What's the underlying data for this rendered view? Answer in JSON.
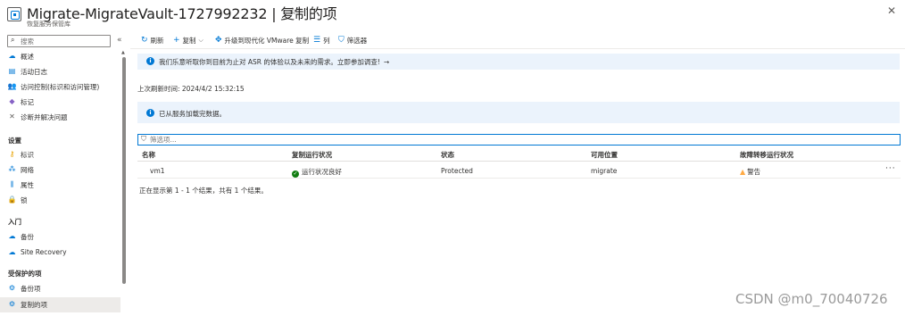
{
  "header": {
    "title": "Migrate-MigrateVault-1727992232 | 复制的项",
    "subtitle": "恢复服务保管库"
  },
  "sidebar": {
    "search_placeholder": "搜索",
    "items_top": [
      {
        "label": "概述",
        "icon": "overview-icon"
      },
      {
        "label": "活动日志",
        "icon": "activity-log-icon"
      },
      {
        "label": "访问控制(标识和访问管理)",
        "icon": "iam-icon"
      },
      {
        "label": "标记",
        "icon": "tag-icon"
      },
      {
        "label": "诊断并解决问题",
        "icon": "diagnose-icon"
      }
    ],
    "section_settings": "设置",
    "items_settings": [
      {
        "label": "标识",
        "icon": "identity-icon"
      },
      {
        "label": "网络",
        "icon": "network-icon"
      },
      {
        "label": "属性",
        "icon": "properties-icon"
      },
      {
        "label": "锁",
        "icon": "lock-icon"
      }
    ],
    "section_getstarted": "入门",
    "items_getstarted": [
      {
        "label": "备份",
        "icon": "backup-icon"
      },
      {
        "label": "Site Recovery",
        "icon": "site-recovery-icon"
      }
    ],
    "section_protected": "受保护的项",
    "items_protected": [
      {
        "label": "备份项",
        "icon": "backup-items-icon"
      },
      {
        "label": "复制的项",
        "icon": "replicated-items-icon",
        "active": true
      }
    ]
  },
  "toolbar": {
    "refresh": "刷新",
    "replicate": "复制",
    "upgrade": "升级到现代化 VMware 复制",
    "columns": "列",
    "filter": "筛选器"
  },
  "banner_survey": {
    "text": "我们乐意听取你到目前为止对 ASR 的体验以及未来的需求。立即参加调查!",
    "arrow": "→"
  },
  "last_refresh": "上次刷新时间: 2024/4/2 15:32:15",
  "banner_loaded": {
    "text": "已从服务加载完数据。"
  },
  "filter": {
    "placeholder": "筛选项..."
  },
  "table": {
    "columns": [
      "名称",
      "复制运行状况",
      "状态",
      "可用位置",
      "故障转移运行状况"
    ],
    "rows": [
      {
        "name": "vm1",
        "replication_health": "运行状况良好",
        "status": "Protected",
        "location": "migrate",
        "failover_health": "警告"
      }
    ]
  },
  "result_summary": "正在显示第 1 - 1 个结果，共有 1 个结果。",
  "watermark": "CSDN @m0_70040726",
  "colors": {
    "accent": "#0078d4",
    "banner_bg": "#ebf3fc",
    "healthy": "#107c10",
    "warning": "#ffaa44"
  }
}
